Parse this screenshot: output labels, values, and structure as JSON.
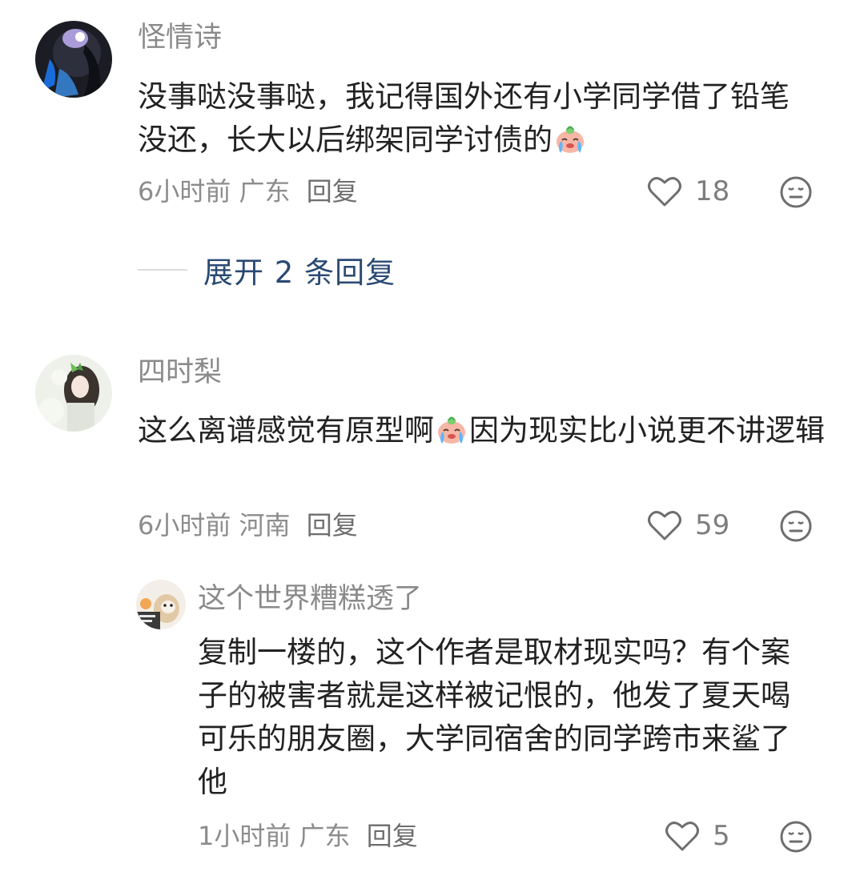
{
  "comments": [
    {
      "username": "怪情诗",
      "text_parts": [
        "没事哒没事哒，我记得国外还有小学同学借了铅笔没还，长大以后绑架同学讨债的"
      ],
      "time": "6小时前",
      "location": "广东",
      "reply_label": "回复",
      "likes": "18",
      "emoji": "crying-face-emoji"
    },
    {
      "username": "四时梨",
      "text_parts": [
        "这么离谱感觉有原型啊",
        "因为现实比小说更不讲逻辑"
      ],
      "time": "6小时前",
      "location": "河南",
      "reply_label": "回复",
      "likes": "59",
      "emoji": "crying-face-emoji"
    }
  ],
  "expand_replies": {
    "label": "展开 2 条回复"
  },
  "sub_reply": {
    "username": "这个世界糟糕透了",
    "text": "复制一楼的，这个作者是取材现实吗？有个案子的被害者就是这样被记恨的，他发了夏天喝可乐的朋友圈，大学同宿舍的同学跨市来鲨了他",
    "time": "1小时前",
    "location": "广东",
    "reply_label": "回复",
    "likes": "5"
  },
  "colors": {
    "link": "#2b4a73",
    "muted": "#8c8c8c",
    "text": "#222222"
  }
}
